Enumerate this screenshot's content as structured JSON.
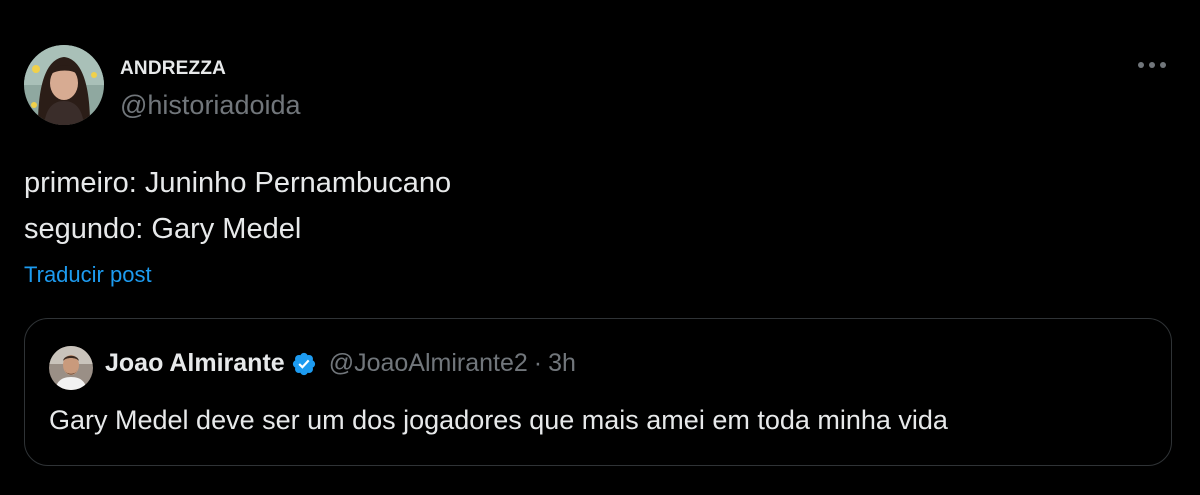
{
  "tweet": {
    "author": {
      "display_name": "ANDREZZA",
      "handle": "@historiadoida",
      "avatar_icon": "avatar-woman-portrait"
    },
    "more_icon": "more-options-icon",
    "text_lines": [
      "primeiro: Juninho Pernambucano",
      "segundo: Gary Medel"
    ],
    "translate_label": "Traducir post"
  },
  "quoted_tweet": {
    "author": {
      "display_name": "Joao Almirante",
      "handle": "@JoaoAlmirante2",
      "verified": true,
      "avatar_icon": "avatar-man-portrait"
    },
    "separator": "·",
    "time": "3h",
    "text": "Gary Medel deve ser um dos jogadores que mais amei em toda minha vida"
  },
  "colors": {
    "background": "#000000",
    "primary_text": "#e7e9ea",
    "secondary_text": "#71767b",
    "link": "#1d9bf0",
    "border": "#2f3336",
    "verified_badge": "#1d9bf0"
  }
}
